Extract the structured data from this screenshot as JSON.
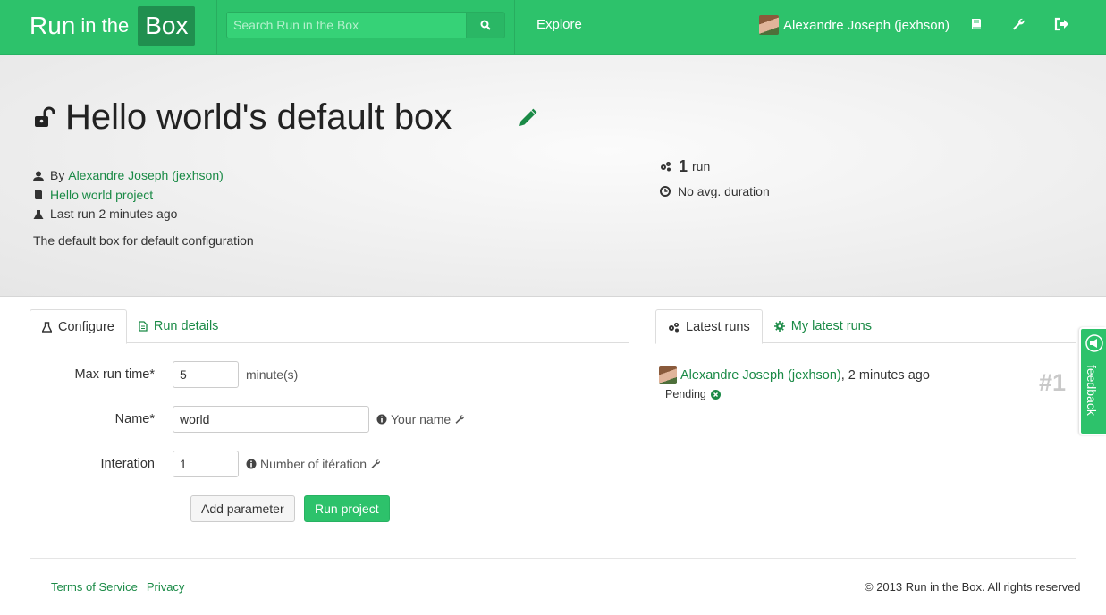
{
  "brand": {
    "run": "Run",
    "in_the": "in the",
    "box": "Box"
  },
  "search": {
    "placeholder": "Search Run in the Box"
  },
  "nav": {
    "explore": "Explore",
    "user": "Alexandre Joseph (jexhson)",
    "icons": [
      "book-icon",
      "wrench-icon",
      "sign-out-icon"
    ]
  },
  "box": {
    "title": "Hello world's default box",
    "by_prefix": "By",
    "author": "Alexandre Joseph (jexhson)",
    "project": "Hello world project",
    "last_run": "Last run 2 minutes ago",
    "description": "The default box for default configuration",
    "runs_count": "1",
    "runs_label": "run",
    "avg_duration": "No avg. duration"
  },
  "left_tabs": [
    {
      "label": "Configure",
      "active": true
    },
    {
      "label": "Run details",
      "active": false
    }
  ],
  "form": {
    "max_run_time": {
      "label": "Max run time*",
      "value": "5",
      "unit": "minute(s)"
    },
    "name": {
      "label": "Name*",
      "value": "world",
      "help": "Your name"
    },
    "iteration": {
      "label": "Interation",
      "value": "1",
      "help": "Number of itération"
    },
    "add_parameter": "Add parameter",
    "run_project": "Run project"
  },
  "right_tabs": [
    {
      "label": "Latest runs",
      "active": true
    },
    {
      "label": "My latest runs",
      "active": false
    }
  ],
  "latest_run": {
    "user": "Alexandre Joseph (jexhson)",
    "time": ", 2 minutes ago",
    "status": "Pending",
    "number": "#1"
  },
  "feedback": "feedback",
  "footer": {
    "terms": "Terms of Service",
    "privacy": "Privacy",
    "copyright": "© 2013 Run in the Box. All rights reserved"
  },
  "colors": {
    "brand_green": "#2dc26b",
    "link_green": "#1a8a46"
  }
}
